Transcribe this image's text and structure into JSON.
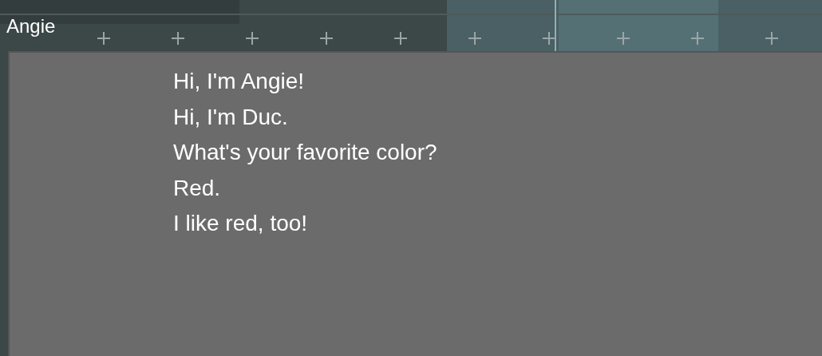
{
  "speaker": {
    "name": "Angie"
  },
  "dialogue": {
    "lines": [
      "Hi, I'm Angie!",
      "Hi, I'm Duc.",
      "What's your favorite color?",
      "Red.",
      "I like red, too!"
    ]
  }
}
